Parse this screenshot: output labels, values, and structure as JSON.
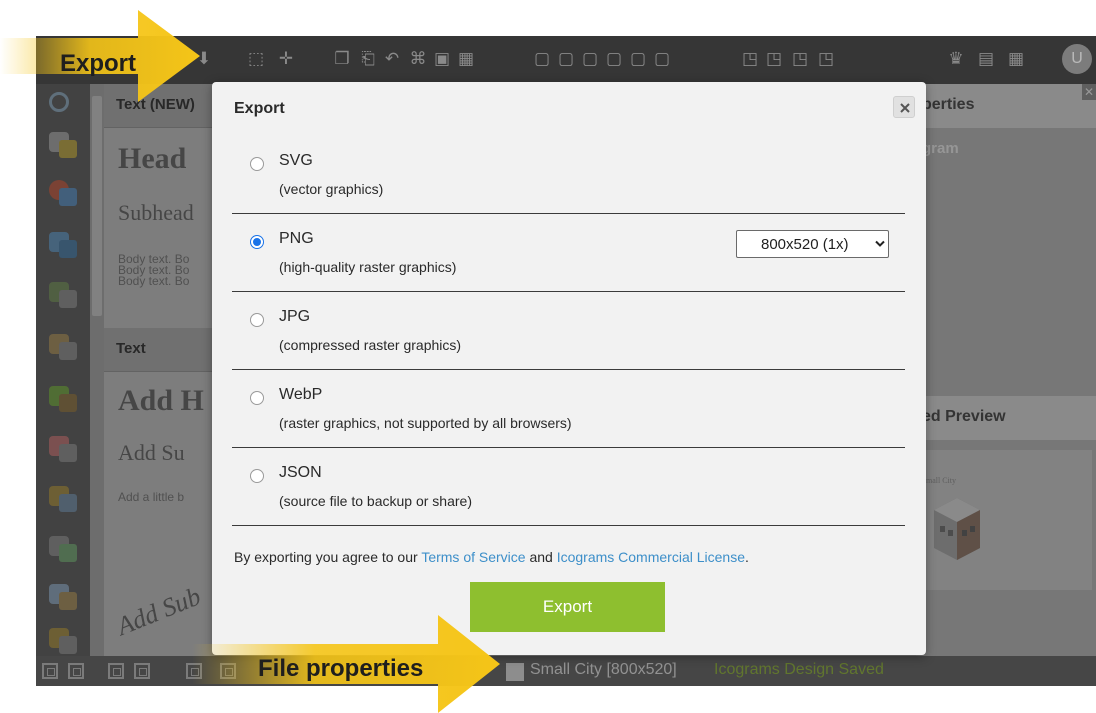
{
  "callouts": {
    "top_label": "Export",
    "bottom_label": "File properties",
    "arrow_color": "#f5c518"
  },
  "toolbar": {
    "icons": [
      "download-icon",
      "select-icon",
      "move-icon",
      "copy-icon",
      "paste-icon",
      "undo-icon",
      "delete-icon",
      "lock-icon",
      "group-icon",
      "align-left-icon",
      "align-center-icon",
      "align-right-icon",
      "align-top-icon",
      "align-middle-icon",
      "align-bottom-icon",
      "bring-front-icon",
      "send-back-icon",
      "layer-up-icon",
      "layer-down-icon",
      "crown-icon",
      "layout-icon",
      "grid-icon"
    ],
    "user_initial": "U"
  },
  "left_panel": {
    "section_text_new": "Text (NEW)",
    "heading": "Head",
    "subheading": "Subhead",
    "body_lines": [
      "Body text. Bo",
      "Body text. Bo",
      "Body text. Bo"
    ],
    "section_text": "Text",
    "add_heading": "Add H",
    "add_subheading": "Add Su",
    "add_body": "Add a little b",
    "script_text": "Add Sub"
  },
  "right_panel": {
    "properties_title": "perties",
    "gram_label": "gram",
    "preview_title": "ed Preview",
    "preview_caption": "mall City"
  },
  "dialog": {
    "title": "Export",
    "options": [
      {
        "name": "SVG",
        "description": "(vector graphics)",
        "checked": false
      },
      {
        "name": "PNG",
        "description": "(high-quality raster graphics)",
        "checked": true
      },
      {
        "name": "JPG",
        "description": "(compressed raster graphics)",
        "checked": false
      },
      {
        "name": "WebP",
        "description": "(raster graphics, not supported by all browsers)",
        "checked": false
      },
      {
        "name": "JSON",
        "description": "(source file to backup or share)",
        "checked": false
      }
    ],
    "size_select_value": "800x520 (1x)",
    "agree_prefix": "By exporting you agree to our ",
    "terms_link": "Terms of Service",
    "agree_and": " and ",
    "license_link": "Icograms Commercial License",
    "agree_suffix": ".",
    "export_button": "Export"
  },
  "statusbar": {
    "file_name": "Small City [800x520]",
    "save_status": "Icograms Design Saved"
  },
  "colors": {
    "accent_green": "#8ebf2f",
    "link_blue": "#3d8fc9",
    "radio_blue": "#1a73e8",
    "toolbar_dark": "#3d3d3d"
  }
}
